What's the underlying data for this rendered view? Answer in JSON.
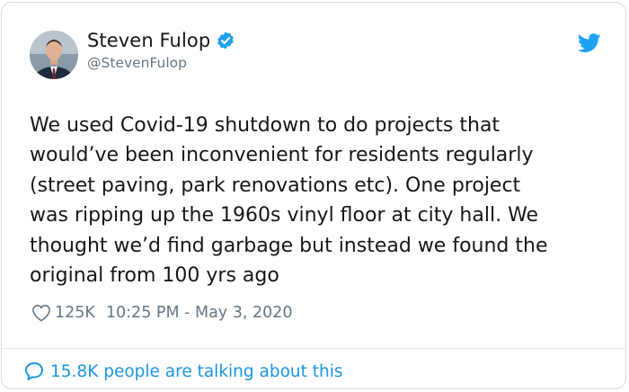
{
  "tweet": {
    "author": {
      "display_name": "Steven Fulop",
      "handle": "@StevenFulop",
      "verified_icon": "verified-badge-icon"
    },
    "brand_icon": "twitter-bird-icon",
    "text": "We used Covid-19 shutdown to do projects that\nwould’ve been inconvenient for residents regularly\n(street paving, park renovations etc). One project\nwas ripping up the 1960s vinyl floor at city hall. We\nthought we’d find garbage but instead we found the\noriginal from 100 yrs ago",
    "likes": "125K",
    "timestamp": "10:25 PM - May 3, 2020",
    "footer": {
      "talking": "15.8K people are talking about this"
    }
  },
  "colors": {
    "twitter_blue": "#1da1f2",
    "link_blue": "#1b95e0",
    "text_primary": "#14171a",
    "text_secondary": "#657786",
    "border": "#d5dbe0"
  }
}
